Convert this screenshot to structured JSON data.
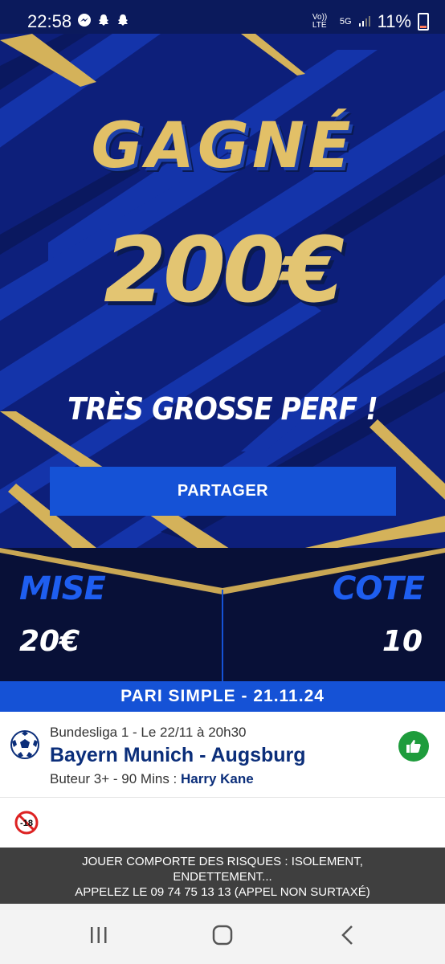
{
  "status_bar": {
    "time": "22:58",
    "network_label": "Vo)) LTE",
    "network_type": "5G",
    "battery": "11%",
    "icons": [
      "messenger-icon",
      "snapchat-icon",
      "snapchat-icon"
    ]
  },
  "result": {
    "title": "GAGNÉ",
    "amount": "200€",
    "message": "TRÈS GROSSE PERF !",
    "share_label": "PARTAGER"
  },
  "stake": {
    "stake_label": "MISE",
    "stake_value": "20€",
    "odds_label": "COTE",
    "odds_value": "10"
  },
  "bet": {
    "type": "PARI SIMPLE - 21.11.24",
    "competition": "Bundesliga 1 - Le 22/11 à 20h30",
    "match": "Bayern Munich - Augsburg",
    "market": "Buteur 3+ - 90 Mins : ",
    "selection": "Harry Kane",
    "status_icon": "thumbs-up-icon",
    "status_color": "#1e9c3c"
  },
  "age_badge": "-18",
  "warning": {
    "line1": "JOUER COMPORTE DES RISQUES : ISOLEMENT, ENDETTEMENT...",
    "line2": "APPELEZ LE 09 74 75 13 13 (APPEL NON SURTAXÉ)"
  },
  "colors": {
    "brand_blue": "#1552d6",
    "gold": "#e2c067",
    "dark_navy": "#081037"
  }
}
